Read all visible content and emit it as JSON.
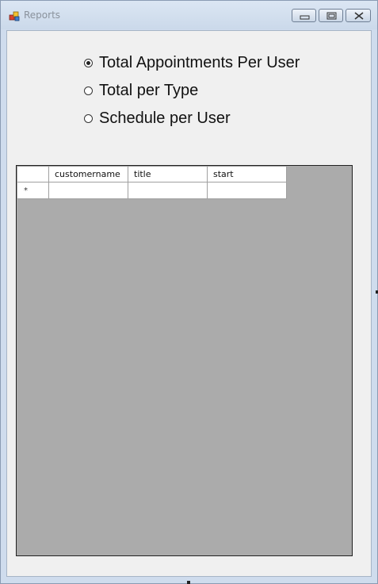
{
  "window": {
    "title": "Reports",
    "icon": "app-icon"
  },
  "report_options": [
    {
      "label": "Total Appointments Per User",
      "checked": true
    },
    {
      "label": "Total per Type",
      "checked": false
    },
    {
      "label": "Schedule per User",
      "checked": false
    }
  ],
  "grid": {
    "columns": [
      "customername",
      "title",
      "start"
    ],
    "new_row_marker": "*",
    "rows": []
  }
}
